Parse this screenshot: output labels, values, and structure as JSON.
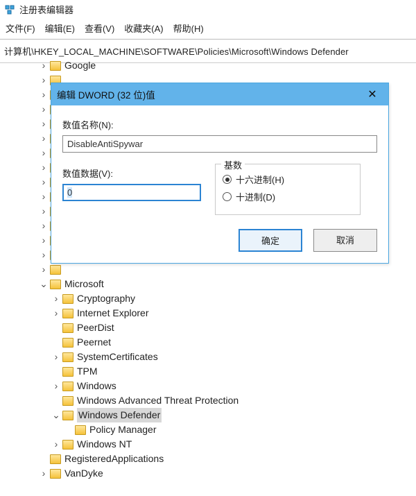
{
  "window": {
    "title": "注册表编辑器"
  },
  "menu": {
    "file": "文件(F)",
    "edit": "编辑(E)",
    "view": "查看(V)",
    "favorites": "收藏夹(A)",
    "help": "帮助(H)"
  },
  "address": "计算机\\HKEY_LOCAL_MACHINE\\SOFTWARE\\Policies\\Microsoft\\Windows Defender",
  "tree": {
    "items_top": [
      {
        "label": "Google",
        "exp": "closed"
      }
    ],
    "microsoft": {
      "label": "Microsoft",
      "children": [
        {
          "label": "Cryptography",
          "exp": "closed"
        },
        {
          "label": "Internet Explorer",
          "exp": "closed"
        },
        {
          "label": "PeerDist",
          "exp": "none"
        },
        {
          "label": "Peernet",
          "exp": "none"
        },
        {
          "label": "SystemCertificates",
          "exp": "closed"
        },
        {
          "label": "TPM",
          "exp": "none"
        },
        {
          "label": "Windows",
          "exp": "closed"
        },
        {
          "label": "Windows Advanced Threat Protection",
          "exp": "none"
        },
        {
          "label": "Windows Defender",
          "exp": "open",
          "selected": true,
          "children": [
            {
              "label": "Policy Manager",
              "exp": "none"
            }
          ]
        },
        {
          "label": "Windows NT",
          "exp": "closed"
        }
      ]
    },
    "items_bottom": [
      {
        "label": "RegisteredApplications",
        "exp": "none"
      },
      {
        "label": "VanDyke",
        "exp": "closed"
      }
    ]
  },
  "dialog": {
    "title": "编辑 DWORD (32 位)值",
    "label_name": "数值名称(N):",
    "value_name": "DisableAntiSpywar",
    "label_data": "数值数据(V):",
    "value_data": "0",
    "base_legend": "基数",
    "radio_hex": "十六进制(H)",
    "radio_dec": "十进制(D)",
    "ok": "确定",
    "cancel": "取消"
  },
  "glyph": {
    "closed": "›",
    "open": "⌄"
  }
}
